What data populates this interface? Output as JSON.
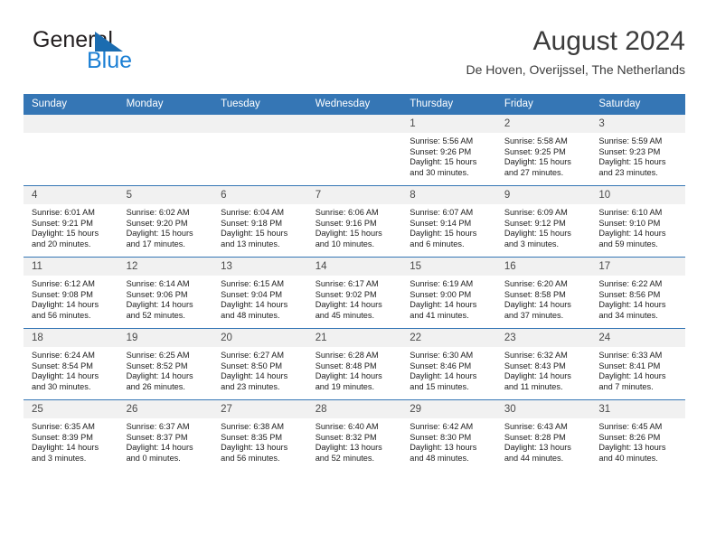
{
  "brand": {
    "name_top": "General",
    "name_bottom": "Blue",
    "triangle_color": "#1b6cb0",
    "blue_color": "#1b7fd4"
  },
  "header": {
    "title": "August 2024",
    "subtitle": "De Hoven, Overijssel, The Netherlands"
  },
  "theme": {
    "header_blue": "#3576b5",
    "daynum_band": "#f1f1f1",
    "row_rule": "#3576b5"
  },
  "labels": {
    "sunrise_prefix": "Sunrise:",
    "sunset_prefix": "Sunset:",
    "daylight_prefix": "Daylight:"
  },
  "weekday_headers": [
    "Sunday",
    "Monday",
    "Tuesday",
    "Wednesday",
    "Thursday",
    "Friday",
    "Saturday"
  ],
  "weeks": [
    [
      {
        "day": "",
        "sunrise": "",
        "sunset": "",
        "daylight_line1": "",
        "daylight_line2": ""
      },
      {
        "day": "",
        "sunrise": "",
        "sunset": "",
        "daylight_line1": "",
        "daylight_line2": ""
      },
      {
        "day": "",
        "sunrise": "",
        "sunset": "",
        "daylight_line1": "",
        "daylight_line2": ""
      },
      {
        "day": "",
        "sunrise": "",
        "sunset": "",
        "daylight_line1": "",
        "daylight_line2": ""
      },
      {
        "day": "1",
        "sunrise": "Sunrise: 5:56 AM",
        "sunset": "Sunset: 9:26 PM",
        "daylight_line1": "Daylight: 15 hours",
        "daylight_line2": "and 30 minutes."
      },
      {
        "day": "2",
        "sunrise": "Sunrise: 5:58 AM",
        "sunset": "Sunset: 9:25 PM",
        "daylight_line1": "Daylight: 15 hours",
        "daylight_line2": "and 27 minutes."
      },
      {
        "day": "3",
        "sunrise": "Sunrise: 5:59 AM",
        "sunset": "Sunset: 9:23 PM",
        "daylight_line1": "Daylight: 15 hours",
        "daylight_line2": "and 23 minutes."
      }
    ],
    [
      {
        "day": "4",
        "sunrise": "Sunrise: 6:01 AM",
        "sunset": "Sunset: 9:21 PM",
        "daylight_line1": "Daylight: 15 hours",
        "daylight_line2": "and 20 minutes."
      },
      {
        "day": "5",
        "sunrise": "Sunrise: 6:02 AM",
        "sunset": "Sunset: 9:20 PM",
        "daylight_line1": "Daylight: 15 hours",
        "daylight_line2": "and 17 minutes."
      },
      {
        "day": "6",
        "sunrise": "Sunrise: 6:04 AM",
        "sunset": "Sunset: 9:18 PM",
        "daylight_line1": "Daylight: 15 hours",
        "daylight_line2": "and 13 minutes."
      },
      {
        "day": "7",
        "sunrise": "Sunrise: 6:06 AM",
        "sunset": "Sunset: 9:16 PM",
        "daylight_line1": "Daylight: 15 hours",
        "daylight_line2": "and 10 minutes."
      },
      {
        "day": "8",
        "sunrise": "Sunrise: 6:07 AM",
        "sunset": "Sunset: 9:14 PM",
        "daylight_line1": "Daylight: 15 hours",
        "daylight_line2": "and 6 minutes."
      },
      {
        "day": "9",
        "sunrise": "Sunrise: 6:09 AM",
        "sunset": "Sunset: 9:12 PM",
        "daylight_line1": "Daylight: 15 hours",
        "daylight_line2": "and 3 minutes."
      },
      {
        "day": "10",
        "sunrise": "Sunrise: 6:10 AM",
        "sunset": "Sunset: 9:10 PM",
        "daylight_line1": "Daylight: 14 hours",
        "daylight_line2": "and 59 minutes."
      }
    ],
    [
      {
        "day": "11",
        "sunrise": "Sunrise: 6:12 AM",
        "sunset": "Sunset: 9:08 PM",
        "daylight_line1": "Daylight: 14 hours",
        "daylight_line2": "and 56 minutes."
      },
      {
        "day": "12",
        "sunrise": "Sunrise: 6:14 AM",
        "sunset": "Sunset: 9:06 PM",
        "daylight_line1": "Daylight: 14 hours",
        "daylight_line2": "and 52 minutes."
      },
      {
        "day": "13",
        "sunrise": "Sunrise: 6:15 AM",
        "sunset": "Sunset: 9:04 PM",
        "daylight_line1": "Daylight: 14 hours",
        "daylight_line2": "and 48 minutes."
      },
      {
        "day": "14",
        "sunrise": "Sunrise: 6:17 AM",
        "sunset": "Sunset: 9:02 PM",
        "daylight_line1": "Daylight: 14 hours",
        "daylight_line2": "and 45 minutes."
      },
      {
        "day": "15",
        "sunrise": "Sunrise: 6:19 AM",
        "sunset": "Sunset: 9:00 PM",
        "daylight_line1": "Daylight: 14 hours",
        "daylight_line2": "and 41 minutes."
      },
      {
        "day": "16",
        "sunrise": "Sunrise: 6:20 AM",
        "sunset": "Sunset: 8:58 PM",
        "daylight_line1": "Daylight: 14 hours",
        "daylight_line2": "and 37 minutes."
      },
      {
        "day": "17",
        "sunrise": "Sunrise: 6:22 AM",
        "sunset": "Sunset: 8:56 PM",
        "daylight_line1": "Daylight: 14 hours",
        "daylight_line2": "and 34 minutes."
      }
    ],
    [
      {
        "day": "18",
        "sunrise": "Sunrise: 6:24 AM",
        "sunset": "Sunset: 8:54 PM",
        "daylight_line1": "Daylight: 14 hours",
        "daylight_line2": "and 30 minutes."
      },
      {
        "day": "19",
        "sunrise": "Sunrise: 6:25 AM",
        "sunset": "Sunset: 8:52 PM",
        "daylight_line1": "Daylight: 14 hours",
        "daylight_line2": "and 26 minutes."
      },
      {
        "day": "20",
        "sunrise": "Sunrise: 6:27 AM",
        "sunset": "Sunset: 8:50 PM",
        "daylight_line1": "Daylight: 14 hours",
        "daylight_line2": "and 23 minutes."
      },
      {
        "day": "21",
        "sunrise": "Sunrise: 6:28 AM",
        "sunset": "Sunset: 8:48 PM",
        "daylight_line1": "Daylight: 14 hours",
        "daylight_line2": "and 19 minutes."
      },
      {
        "day": "22",
        "sunrise": "Sunrise: 6:30 AM",
        "sunset": "Sunset: 8:46 PM",
        "daylight_line1": "Daylight: 14 hours",
        "daylight_line2": "and 15 minutes."
      },
      {
        "day": "23",
        "sunrise": "Sunrise: 6:32 AM",
        "sunset": "Sunset: 8:43 PM",
        "daylight_line1": "Daylight: 14 hours",
        "daylight_line2": "and 11 minutes."
      },
      {
        "day": "24",
        "sunrise": "Sunrise: 6:33 AM",
        "sunset": "Sunset: 8:41 PM",
        "daylight_line1": "Daylight: 14 hours",
        "daylight_line2": "and 7 minutes."
      }
    ],
    [
      {
        "day": "25",
        "sunrise": "Sunrise: 6:35 AM",
        "sunset": "Sunset: 8:39 PM",
        "daylight_line1": "Daylight: 14 hours",
        "daylight_line2": "and 3 minutes."
      },
      {
        "day": "26",
        "sunrise": "Sunrise: 6:37 AM",
        "sunset": "Sunset: 8:37 PM",
        "daylight_line1": "Daylight: 14 hours",
        "daylight_line2": "and 0 minutes."
      },
      {
        "day": "27",
        "sunrise": "Sunrise: 6:38 AM",
        "sunset": "Sunset: 8:35 PM",
        "daylight_line1": "Daylight: 13 hours",
        "daylight_line2": "and 56 minutes."
      },
      {
        "day": "28",
        "sunrise": "Sunrise: 6:40 AM",
        "sunset": "Sunset: 8:32 PM",
        "daylight_line1": "Daylight: 13 hours",
        "daylight_line2": "and 52 minutes."
      },
      {
        "day": "29",
        "sunrise": "Sunrise: 6:42 AM",
        "sunset": "Sunset: 8:30 PM",
        "daylight_line1": "Daylight: 13 hours",
        "daylight_line2": "and 48 minutes."
      },
      {
        "day": "30",
        "sunrise": "Sunrise: 6:43 AM",
        "sunset": "Sunset: 8:28 PM",
        "daylight_line1": "Daylight: 13 hours",
        "daylight_line2": "and 44 minutes."
      },
      {
        "day": "31",
        "sunrise": "Sunrise: 6:45 AM",
        "sunset": "Sunset: 8:26 PM",
        "daylight_line1": "Daylight: 13 hours",
        "daylight_line2": "and 40 minutes."
      }
    ]
  ]
}
